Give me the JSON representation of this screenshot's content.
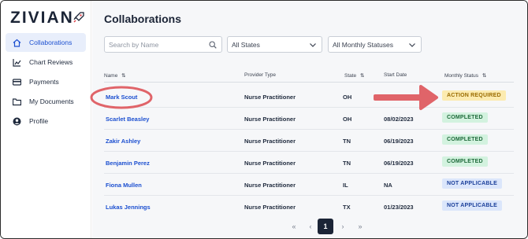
{
  "app": {
    "logo": "ZIVIAN",
    "rocket_icon": "rocket-icon"
  },
  "sidebar": {
    "items": [
      {
        "label": "Collaborations",
        "icon": "home-icon",
        "active": true
      },
      {
        "label": "Chart Reviews",
        "icon": "chart-icon",
        "active": false
      },
      {
        "label": "Payments",
        "icon": "card-icon",
        "active": false
      },
      {
        "label": "My Documents",
        "icon": "folder-icon",
        "active": false
      },
      {
        "label": "Profile",
        "icon": "user-icon",
        "active": false
      }
    ]
  },
  "page": {
    "title": "Collaborations"
  },
  "filters": {
    "search_placeholder": "Search by Name",
    "states_value": "All States",
    "statuses_value": "All Monthly Statuses"
  },
  "table": {
    "headers": {
      "name": "Name",
      "provider_type": "Provider Type",
      "state": "State",
      "start_date": "Start Date",
      "monthly_status": "Monthly Status"
    },
    "rows": [
      {
        "name": "Mark Scout",
        "provider_type": "Nurse Practitioner",
        "state": "OH",
        "start_date": "",
        "status": "ACTION REQUIRED",
        "status_kind": "action"
      },
      {
        "name": "Scarlet Beasley",
        "provider_type": "Nurse Practitioner",
        "state": "OH",
        "start_date": "08/02/2023",
        "status": "COMPLETED",
        "status_kind": "completed"
      },
      {
        "name": "Zakir Ashley",
        "provider_type": "Nurse Practitioner",
        "state": "TN",
        "start_date": "06/19/2023",
        "status": "COMPLETED",
        "status_kind": "completed"
      },
      {
        "name": "Benjamin Perez",
        "provider_type": "Nurse Practitioner",
        "state": "TN",
        "start_date": "06/19/2023",
        "status": "COMPLETED",
        "status_kind": "completed"
      },
      {
        "name": "Fiona Mullen",
        "provider_type": "Nurse Practitioner",
        "state": "IL",
        "start_date": "NA",
        "status": "NOT APPLICABLE",
        "status_kind": "na"
      },
      {
        "name": "Lukas Jennings",
        "provider_type": "Nurse Practitioner",
        "state": "TX",
        "start_date": "01/23/2023",
        "status": "NOT APPLICABLE",
        "status_kind": "na"
      }
    ]
  },
  "pagination": {
    "first": "«",
    "prev": "‹",
    "current": "1",
    "next": "›",
    "last": "»"
  },
  "colors": {
    "accent": "#1b4fd0",
    "action_bg": "#fcebb0",
    "action_fg": "#9a6b00",
    "completed_bg": "#d3f2df",
    "completed_fg": "#1e6a3a",
    "na_bg": "#dbe6fb",
    "na_fg": "#1b3f9a",
    "annotation": "#e06469"
  }
}
